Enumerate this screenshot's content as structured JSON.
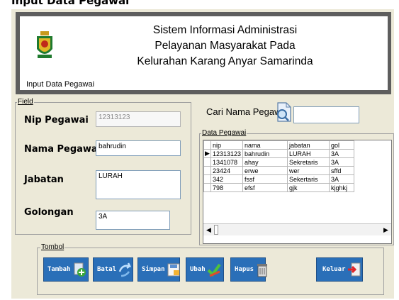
{
  "app": {
    "caption_top": "Input Data Pegawai",
    "header_caption": "Input Data Pegawai",
    "title_lines": [
      "Sistem Informasi Administrasi",
      "Pelayanan Masyarakat Pada",
      "Kelurahan Karang Anyar Samarinda"
    ],
    "logo_icon": "city-emblem-icon"
  },
  "field_group": {
    "legend": "Field",
    "labels": {
      "nip": "Nip Pegawai",
      "nama": "Nama Pegawai",
      "jabatan": "Jabatan",
      "golongan": "Golongan"
    },
    "values": {
      "nip": "12313123",
      "nama": "bahrudin",
      "jabatan": "LURAH",
      "golongan": "3A"
    }
  },
  "search": {
    "label": "Cari Nama Pegawai",
    "value": "",
    "icon": "search-document-icon"
  },
  "data_group": {
    "legend": "Data Pegawai",
    "columns": [
      "nip",
      "nama",
      "jabatan",
      "gol"
    ],
    "rows": [
      [
        "12313123",
        "bahrudin",
        "LURAH",
        "3A"
      ],
      [
        "1341078",
        "ahay",
        "Sekretaris",
        "3A"
      ],
      [
        "23424",
        "erwe",
        "wer",
        "sffd"
      ],
      [
        "342",
        "fssf",
        "Sekertaris",
        "3A"
      ],
      [
        "798",
        "efsf",
        "gjk",
        "kjghkj"
      ]
    ]
  },
  "tombol": {
    "legend": "Tombol",
    "buttons": [
      "Tambah",
      "Batal",
      "Simpan",
      "Ubah",
      "Hapus",
      "Keluar"
    ],
    "icons": [
      "add-icon",
      "undo-icon",
      "save-icon",
      "check-icon",
      "trash-icon",
      "exit-icon"
    ]
  },
  "colors": {
    "header_border": "#5e5e5e",
    "window_bg": "#ece9d8",
    "button_blue": "#2a6fb8"
  }
}
